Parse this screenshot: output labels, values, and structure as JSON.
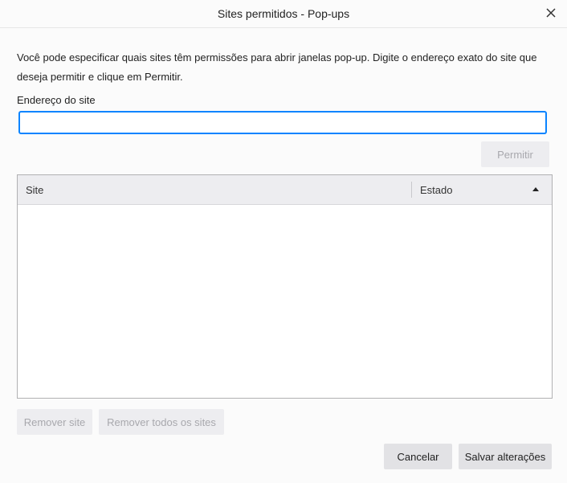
{
  "window": {
    "title": "Sites permitidos - Pop-ups",
    "close_icon": "close-icon"
  },
  "description": "Você pode especificar quais sites têm permissões para abrir janelas pop-up. Digite o endereço exato do site que deseja permitir e clique em Permitir.",
  "address": {
    "label": "Endereço do site",
    "value": "",
    "placeholder": ""
  },
  "buttons": {
    "allow": "Permitir",
    "remove_site": "Remover site",
    "remove_all": "Remover todos os sites",
    "cancel": "Cancelar",
    "save": "Salvar alterações"
  },
  "table": {
    "columns": [
      "Site",
      "Estado"
    ],
    "sort_icon": "sort-ascending-icon",
    "rows": []
  },
  "colors": {
    "accent": "#0a84ff",
    "disabled_text": "#a8a8ad"
  }
}
